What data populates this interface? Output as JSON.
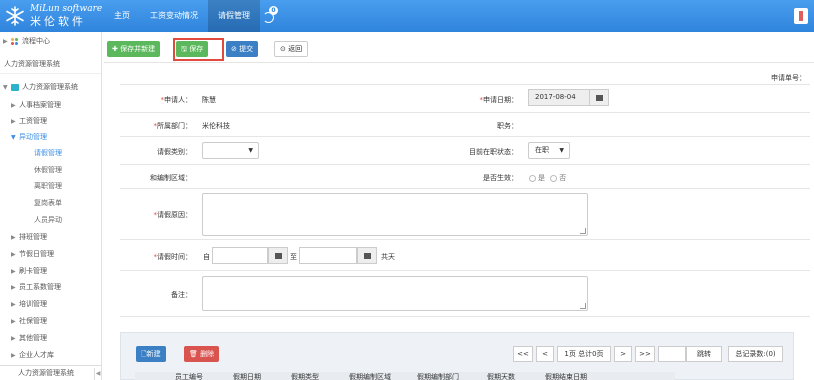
{
  "header": {
    "logo_en": "MiLun software",
    "logo_cn": "米伦软件",
    "nav": [
      "主页",
      "工资变动情况",
      "请假管理"
    ],
    "badge_count": "0"
  },
  "sidebar": {
    "top_item": "流程中心",
    "system_label": "人力资源管理系统",
    "root": "人力资源管理系统",
    "items": [
      "人事档案管理",
      "工资管理",
      "异动管理"
    ],
    "sub_items": [
      "请假管理",
      "休假管理",
      "离职管理",
      "复岗表单",
      "人员异动"
    ],
    "items2": [
      "排班管理",
      "节假日管理",
      "刷卡管理",
      "员工系数管理",
      "培训管理",
      "社保管理",
      "其他管理",
      "企业人才库"
    ],
    "bottom": "人力资源管理系统"
  },
  "toolbar": {
    "save_new": "保存并新建",
    "save": "保存",
    "submit": "提交",
    "back": "返回"
  },
  "form": {
    "doc_no_label": "申请单号：",
    "applicant_label": "申请人：",
    "applicant_value": "陈慧",
    "date_label": "申请日期：",
    "date_value": "2017-08-04",
    "dept_label": "所属部门：",
    "dept_value": "米伦科技",
    "position_label": "职务：",
    "leave_type_label": "请假类别：",
    "status_label": "目前在职状态：",
    "status_value": "在职",
    "area_label": "和编制区域：",
    "effective_label": "是否生效：",
    "yes": "是",
    "no": "否",
    "reason_label": "请假原因：",
    "time_label": "请假时间：",
    "from": "自",
    "to": "至",
    "total": "共天",
    "remark_label": "备注："
  },
  "table_panel": {
    "new_btn": "新建",
    "delete_btn": "删除",
    "first": "<<",
    "prev": "<",
    "page_info": "1页 总计0页",
    "next": ">",
    "last": ">>",
    "jump": "跳转",
    "total_records": "总记录数:(0)",
    "columns": [
      "",
      "员工编号",
      "假期日期",
      "假期类型",
      "假期编制区域",
      "假期编制部门",
      "假期天数",
      "假期结束日期"
    ]
  }
}
